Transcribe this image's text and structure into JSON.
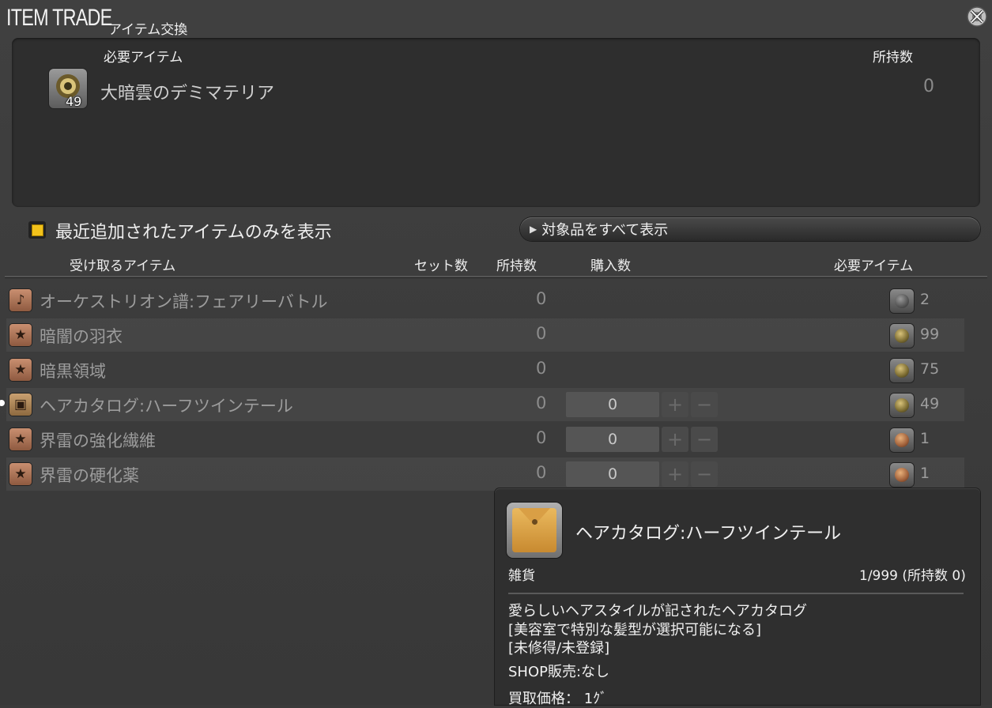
{
  "window": {
    "title": "ITEM TRADE",
    "subtitle": "アイテム交換",
    "close_icon": "close-gear-icon"
  },
  "required": {
    "header_item": "必要アイテム",
    "header_owned": "所持数",
    "item_name": "大暗雲のデミマテリア",
    "item_icon_count": "49",
    "owned": "0"
  },
  "filter": {
    "checkbox_label": "最近追加されたアイテムのみを表示",
    "checked": true,
    "show_all_label": "対象品をすべて表示"
  },
  "columns": {
    "receive": "受け取るアイテム",
    "sets": "セット数",
    "owned": "所持数",
    "buy": "購入数",
    "required": "必要アイテム"
  },
  "rows": [
    {
      "name": "オーケストリオン譜:フェアリーバトル",
      "owned": "0",
      "qty": "",
      "cost": "2",
      "icon": "music-note-icon",
      "cost_icon": "gear"
    },
    {
      "name": "暗闇の羽衣",
      "owned": "0",
      "qty": "",
      "cost": "99",
      "icon": "star-icon",
      "cost_icon": "orb"
    },
    {
      "name": "暗黒領域",
      "owned": "0",
      "qty": "",
      "cost": "75",
      "icon": "star-icon",
      "cost_icon": "orb"
    },
    {
      "name": "ヘアカタログ:ハーフツインテール",
      "owned": "0",
      "qty": "0",
      "cost": "49",
      "icon": "box-icon",
      "cost_icon": "orb"
    },
    {
      "name": "界雷の強化繊維",
      "owned": "0",
      "qty": "0",
      "cost": "1",
      "icon": "star-icon",
      "cost_icon": "amber"
    },
    {
      "name": "界雷の硬化薬",
      "owned": "0",
      "qty": "0",
      "cost": "1",
      "icon": "star-icon",
      "cost_icon": "amber"
    }
  ],
  "stepper": {
    "plus": "+",
    "minus": "−"
  },
  "tooltip": {
    "name": "ヘアカタログ:ハーフツインテール",
    "category": "雑貨",
    "stack": "1/999 (所持数 0)",
    "desc_1": "愛らしいヘアスタイルが記されたヘアカタログ",
    "desc_2": "[美容室で特別な髪型が選択可能になる]",
    "desc_3": "[未修得/未登録]",
    "shop": "SHOP販売:なし",
    "price": "買取価格： 1ｸﾞ"
  },
  "colors": {
    "checkbox": "#f2c21b",
    "background": "#3a3a3a",
    "panel": "#2e2e2e"
  }
}
